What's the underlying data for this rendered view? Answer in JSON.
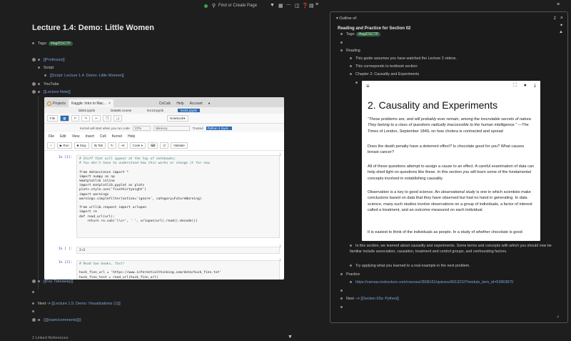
{
  "topbar": {
    "search_label": "Find or Create Page",
    "icons": [
      "search-icon",
      "filter-icon",
      "calendar-icon",
      "more-icon",
      "panel-icon",
      "help-icon",
      "sidebar-icon"
    ]
  },
  "page": {
    "title": "Lecture 1.4: Demo: Little Women",
    "tags_label": "Tags:",
    "tag": "#tag/DSCTP",
    "professor": "[[Professor]]",
    "script_label": "Script",
    "script_link": "[[Script: Lecture 1.4: Demo: Little Women]]",
    "youtube_label": "YouTube",
    "lecture_note": "[[Lecture Note]]",
    "key_takeaway": "[[Key Takeaway]]",
    "next_prefix": "Next ->",
    "next_link": "[[Lecture 1.5: Demo: Visualizations (1)]]",
    "roam_comments": "{{[[roam/comments]]}}",
    "linked_refs": "2 Linked References"
  },
  "notebook": {
    "tabs": [
      {
        "label": "Projects"
      },
      {
        "label": "Kaggle: Intro to Mac..."
      },
      {
        "label": "CoCalc"
      },
      {
        "label": "Help"
      },
      {
        "label": "Account"
      }
    ],
    "file_tabs": [
      "lab02.ipynb",
      "Data80.course",
      "lec13.ipynb",
      "lec01.ipynb"
    ],
    "file_label": "File",
    "notebook_label": "Notebook",
    "kernel_msg": "Kernel will start when you run code",
    "cpu_label": "CPU",
    "memory_label": "Memory",
    "trusted_label": "Trusted",
    "kernel_name": "Python 3 (syst...",
    "menu": [
      "File",
      "Edit",
      "View",
      "Insert",
      "Cell",
      "Kernel",
      "Help"
    ],
    "toolbar": {
      "run": "Run",
      "stop": "Stop",
      "tab": "Tab",
      "code": "Code",
      "validate": "Validate"
    },
    "cells": [
      {
        "prompt": "In [1]:",
        "num": "1"
      },
      {
        "prompt": "In [ ]:",
        "num": "1",
        "code": "2+2"
      },
      {
        "prompt": "In [2]:",
        "num": "1"
      }
    ],
    "cell1": {
      "c1": "# Stuff that will appear at the top of notebooks;",
      "c2": "# You don't have to understand how this works or change it for now.",
      "l3": "from datascience import *",
      "l4": "import numpy as np",
      "l5": "%matplotlib inline",
      "l6": "import matplotlib.pyplot as plots",
      "l7": "plots.style.use('fivethirtyeight')",
      "l8": "import warnings",
      "l9": "warnings.simplefilter(action='ignore', category=FutureWarning)",
      "l10": "from urllib.request import urlopen",
      "l11": "import re",
      "l12": "def read_url(url):",
      "l13": "    return re.sub('\\\\s+', ' ', urlopen(url).read().decode())"
    },
    "cell3": {
      "c1": "# Read two books, fast!",
      "l2": "huck_finn_url = 'https://www.inferentialthinking.com/data/huck_finn.txt'",
      "l3": "huck_finn_text = read_url(huck_finn_url)"
    }
  },
  "sidebar": {
    "outline_label": "Outline of:",
    "count": "2",
    "title": "Reading and Practice for Section 02",
    "tags_label": "Tags:",
    "tag": "#tag/DSCTP",
    "reading_label": "Reading",
    "r1": "This guide assumes you have watched the Lecture 2 videos.",
    "r2": "This corresponds to textbook section:",
    "r3": "Chapter 2: Causality and Experiments",
    "after1": "In this section, we learned about causality and experiments.  Some terms and concepts with which you should now be familiar include association, causation, treatment and control groups, and confounding factors.",
    "after2": "Try applying what you learned to a real example in the next problem.",
    "practice_label": "Practice",
    "practice_link": "https://canvas.instructure.com/courses/3508161/quizzes/9013210?module_item_id=53963879",
    "next_prefix": "Next -->",
    "next_link": "[[Section 03a: Python]]"
  },
  "book": {
    "heading": "2. Causality and Experiments",
    "quote_italic": "“These problems are, and will probably ever remain, among the inscrutable secrets of nature. They belong to a class of questions radically inaccessible to the human intelligence.”",
    "quote_attr": " —The Times of London, September 1849, on how cholera is contracted and spread",
    "p1": "Does the death penalty have a deterrent effect? Is chocolate good for you? What causes breast cancer?",
    "p2": "All of these questions attempt to assign a cause to an effect. A careful examination of data can help shed light on questions like these. In this section you will learn some of the fundamental concepts involved in establishing causality.",
    "p3_a": "Observation is a key to good science. An ",
    "p3_em": "observational study",
    "p3_b": " is one in which scientists make conclusions based on data that they have observed but had no hand in generating. In data science, many such studies involve observations on a group of individuals, a factor of interest called a treatment, and an outcome measured on each individual.",
    "p4": "It is easiest to think of the individuals as people. In a study of whether chocolate is good"
  }
}
